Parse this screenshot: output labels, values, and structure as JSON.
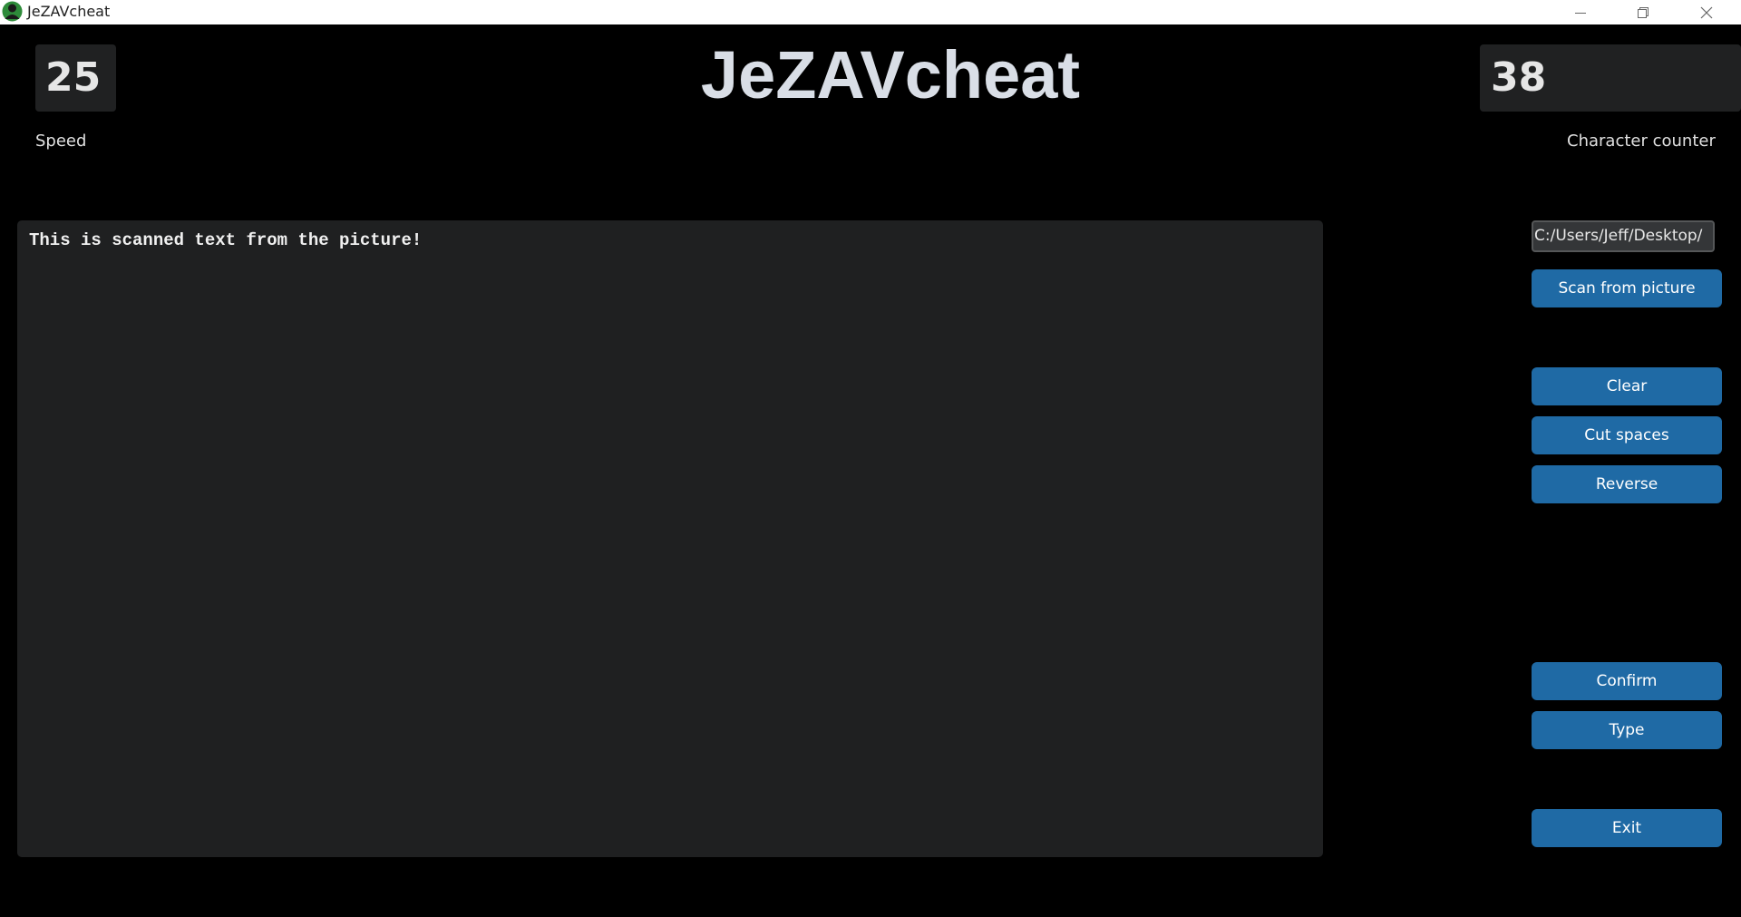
{
  "window": {
    "title": "JeZAVcheat",
    "icon": "app-avatar-icon",
    "controls": [
      "minimize-icon",
      "restore-icon",
      "close-icon"
    ]
  },
  "header": {
    "title": "JeZAVcheat"
  },
  "speed": {
    "value": "25",
    "label": "Speed"
  },
  "character_counter": {
    "value": "38",
    "label": "Character counter"
  },
  "editor": {
    "text": "This is scanned text from the picture!"
  },
  "sidebar": {
    "path_value": "C:/Users/Jeff/Desktop/",
    "scan_label": "Scan from picture",
    "clear_label": "Clear",
    "cut_spaces_label": "Cut spaces",
    "reverse_label": "Reverse",
    "confirm_label": "Confirm",
    "type_label": "Type",
    "exit_label": "Exit"
  },
  "colors": {
    "background": "#000000",
    "panel": "#1f2021",
    "accent": "#1f6aa5",
    "heading": "#d9dee6"
  }
}
